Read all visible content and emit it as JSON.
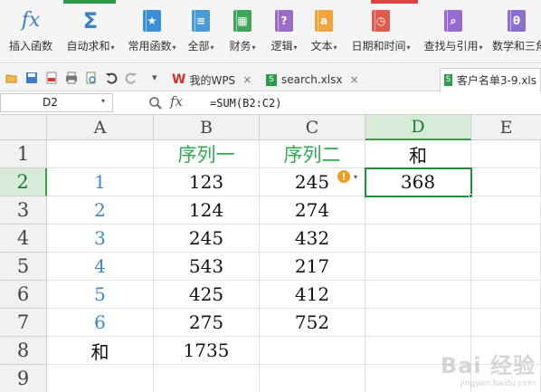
{
  "ribbon": {
    "items": [
      {
        "label": "插入函数",
        "icon": "fx-icon",
        "dropdown": false
      },
      {
        "label": "自动求和",
        "icon": "sigma-icon",
        "dropdown": true
      },
      {
        "label": "常用函数",
        "icon": "star-book-icon",
        "dropdown": true
      },
      {
        "label": "全部",
        "icon": "list-book-icon",
        "dropdown": true
      },
      {
        "label": "财务",
        "icon": "finance-book-icon",
        "dropdown": true
      },
      {
        "label": "逻辑",
        "icon": "question-book-icon",
        "dropdown": true
      },
      {
        "label": "文本",
        "icon": "text-book-icon",
        "dropdown": true
      },
      {
        "label": "日期和时间",
        "icon": "clock-book-icon",
        "dropdown": true
      },
      {
        "label": "查找与引用",
        "icon": "search-book-icon",
        "dropdown": true
      },
      {
        "label": "数学和三角",
        "icon": "theta-book-icon",
        "dropdown": false
      }
    ],
    "dropdown_glyph": "▾"
  },
  "glyphs": {
    "fx": "fx",
    "sigma": "Σ",
    "question": "?",
    "text_a": "a",
    "theta": "θ",
    "close": "×",
    "collapse": "▾",
    "warn": "!"
  },
  "tabs": [
    {
      "label": "我的WPS",
      "icon": "wps-logo-icon",
      "closable": true,
      "active": false
    },
    {
      "label": "search.xlsx",
      "icon": "excel-file-icon",
      "closable": true,
      "active": false
    },
    {
      "label": "客户名单3-9.xls",
      "icon": "excel-file-icon",
      "closable": false,
      "active": true
    }
  ],
  "formula_bar": {
    "name_box": "D2",
    "fx_label": "fx",
    "formula": "=SUM(B2:C2)"
  },
  "sheet": {
    "columns": [
      "A",
      "B",
      "C",
      "D",
      "E"
    ],
    "rows": [
      "1",
      "2",
      "3",
      "4",
      "5",
      "6",
      "7",
      "8",
      "9"
    ],
    "selected_column": "D",
    "selected_row": "2",
    "cells": {
      "B1": "序列一",
      "C1": "序列二",
      "D1": "和",
      "A2": "1",
      "B2": "123",
      "C2": "245",
      "D2": "368",
      "A3": "2",
      "B3": "124",
      "C3": "274",
      "A4": "3",
      "B4": "245",
      "C4": "432",
      "A5": "4",
      "B5": "543",
      "C5": "217",
      "A6": "5",
      "B6": "425",
      "C6": "412",
      "A7": "6",
      "B7": "275",
      "C7": "752",
      "A8": "和",
      "B8": "1735"
    }
  },
  "colors": {
    "accent_green": "#1e8f3a",
    "header_green": "#2eaa52",
    "index_blue": "#3f86c9",
    "warning": "#f29b21"
  },
  "watermark": {
    "logo": "Bai 经验",
    "url": "jingyan.baidu.com"
  }
}
